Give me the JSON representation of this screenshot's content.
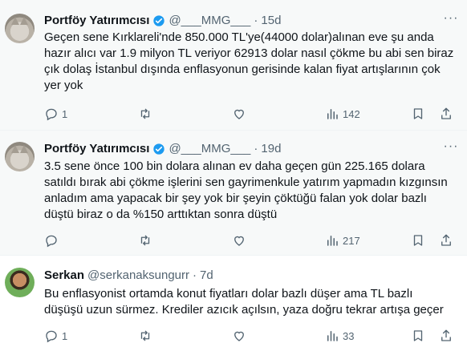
{
  "tweets": [
    {
      "name": "Portföy Yatırımcısı",
      "handle": "@___MMG___",
      "time": "15d",
      "text": "Geçen sene Kırklareli'nde 850.000 TL'ye(44000 dolar)alınan eve şu anda\nhazır alıcı var 1.9 milyon TL veriyor 62913 dolar nasıl çökme bu abi sen biraz\nçık dolaş İstanbul dışında enflasyonun gerisinde kalan fiyat artışlarının çok\nyer yok",
      "replies": "1",
      "views": "142"
    },
    {
      "name": "Portföy Yatırımcısı",
      "handle": "@___MMG___",
      "time": "19d",
      "text": "3.5 sene önce 100 bin dolara alınan ev daha geçen gün 225.165 dolara\nsatıldı bırak abi çökme işlerini sen gayrimenkule yatırım yapmadın kızgınsın\nanladım ama yapacak bir şey yok bir şeyin çöktüğü falan yok dolar bazlı\ndüştü biraz o da %150 arttıktan sonra düştü",
      "replies": "",
      "views": "217"
    },
    {
      "name": "Serkan",
      "handle": "@serkanaksungurr",
      "time": "7d",
      "text": "Bu enflasyonist ortamda konut fiyatları dolar bazlı düşer ama TL bazlı\ndüşüşü uzun sürmez. Krediler azıcık açılsın, yaza doğru tekrar artışa geçer",
      "replies": "1",
      "views": "33"
    }
  ],
  "separator": "·",
  "more": "···",
  "icons": [
    "reply-icon",
    "retweet-icon",
    "like-icon",
    "views-icon",
    "bookmark-icon",
    "share-icon",
    "verified-icon"
  ],
  "colors": {
    "verified": "#1d9bf0",
    "muted": "#536471",
    "text": "#0f1419",
    "highlight": "#f7f9f9"
  }
}
